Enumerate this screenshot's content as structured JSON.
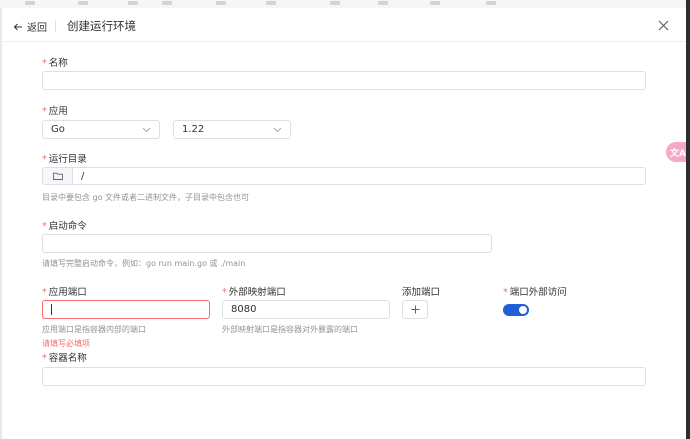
{
  "header": {
    "back_label": "返回",
    "title": "创建运行环境"
  },
  "fields": {
    "name": {
      "label": "名称",
      "value": "",
      "placeholder": ""
    },
    "app": {
      "label": "应用",
      "language": "Go",
      "version": "1.22"
    },
    "run_dir": {
      "label": "运行目录",
      "value": "/",
      "hint": "目录中要包含 go 文件或者二进制文件，子目录中包含也可"
    },
    "start_cmd": {
      "label": "启动命令",
      "value": "",
      "hint": "请填写完整启动命令，例如：go run main.go 或 ./main"
    },
    "app_port": {
      "label": "应用端口",
      "value": "",
      "hint": "应用端口是指容器内部的端口",
      "error": "请填写必填项"
    },
    "ext_port": {
      "label": "外部映射端口",
      "value": "8080",
      "hint": "外部映射端口是指容器对外暴露的端口"
    },
    "add_port": {
      "label": "添加端口"
    },
    "port_external": {
      "label": "端口外部访问",
      "enabled": true
    },
    "container_name": {
      "label": "容器名称",
      "value": ""
    }
  },
  "floating": {
    "label": "文A"
  },
  "icons": [
    "arrow-left-icon",
    "close-icon",
    "chevron-down-icon",
    "folder-icon",
    "plus-icon",
    "translate-icon"
  ]
}
